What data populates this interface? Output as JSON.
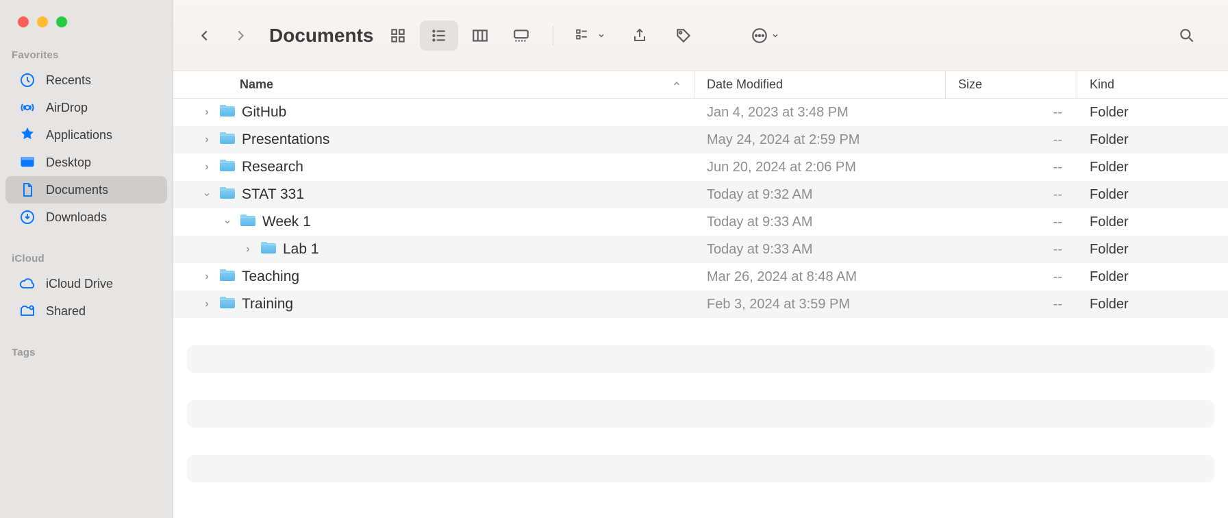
{
  "window": {
    "title": "Documents"
  },
  "sidebar": {
    "sections": {
      "favorites_label": "Favorites",
      "icloud_label": "iCloud",
      "tags_label": "Tags"
    },
    "favorites": [
      {
        "label": "Recents",
        "icon": "clock-icon"
      },
      {
        "label": "AirDrop",
        "icon": "airdrop-icon"
      },
      {
        "label": "Applications",
        "icon": "applications-icon"
      },
      {
        "label": "Desktop",
        "icon": "desktop-icon"
      },
      {
        "label": "Documents",
        "icon": "document-icon",
        "active": true
      },
      {
        "label": "Downloads",
        "icon": "downloads-icon"
      }
    ],
    "icloud": [
      {
        "label": "iCloud Drive",
        "icon": "cloud-icon"
      },
      {
        "label": "Shared",
        "icon": "shared-folder-icon"
      }
    ]
  },
  "columns": {
    "name": "Name",
    "date": "Date Modified",
    "size": "Size",
    "kind": "Kind"
  },
  "rows": [
    {
      "name": "GitHub",
      "date": "Jan 4, 2023 at 3:48 PM",
      "size": "--",
      "kind": "Folder",
      "indent": 0,
      "expanded": false
    },
    {
      "name": "Presentations",
      "date": "May 24, 2024 at 2:59 PM",
      "size": "--",
      "kind": "Folder",
      "indent": 0,
      "expanded": false
    },
    {
      "name": "Research",
      "date": "Jun 20, 2024 at 2:06 PM",
      "size": "--",
      "kind": "Folder",
      "indent": 0,
      "expanded": false
    },
    {
      "name": "STAT 331",
      "date": "Today at 9:32 AM",
      "size": "--",
      "kind": "Folder",
      "indent": 0,
      "expanded": true
    },
    {
      "name": "Week 1",
      "date": "Today at 9:33 AM",
      "size": "--",
      "kind": "Folder",
      "indent": 1,
      "expanded": true
    },
    {
      "name": "Lab 1",
      "date": "Today at 9:33 AM",
      "size": "--",
      "kind": "Folder",
      "indent": 2,
      "expanded": false
    },
    {
      "name": "Teaching",
      "date": "Mar 26, 2024 at 8:48 AM",
      "size": "--",
      "kind": "Folder",
      "indent": 0,
      "expanded": false
    },
    {
      "name": "Training",
      "date": "Feb 3, 2024 at 3:59 PM",
      "size": "--",
      "kind": "Folder",
      "indent": 0,
      "expanded": false
    }
  ]
}
